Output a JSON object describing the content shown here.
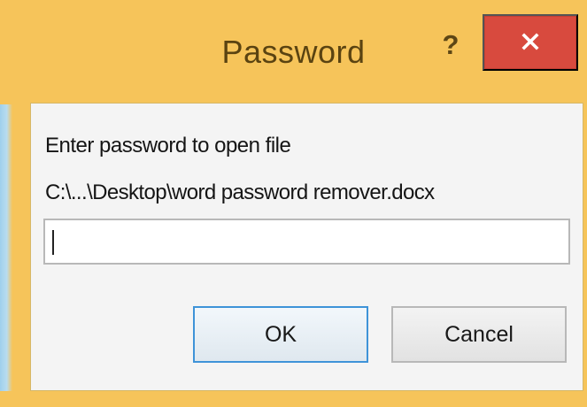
{
  "window": {
    "title": "Password",
    "help_label": "?",
    "close_icon": "close-icon",
    "frame_color": "#f6c45a",
    "close_color": "#d84a3e"
  },
  "dialog": {
    "prompt": "Enter password to open file",
    "file_path": "C:\\...\\Desktop\\word password remover.docx",
    "password_value": ""
  },
  "buttons": {
    "ok_label": "OK",
    "cancel_label": "Cancel"
  }
}
